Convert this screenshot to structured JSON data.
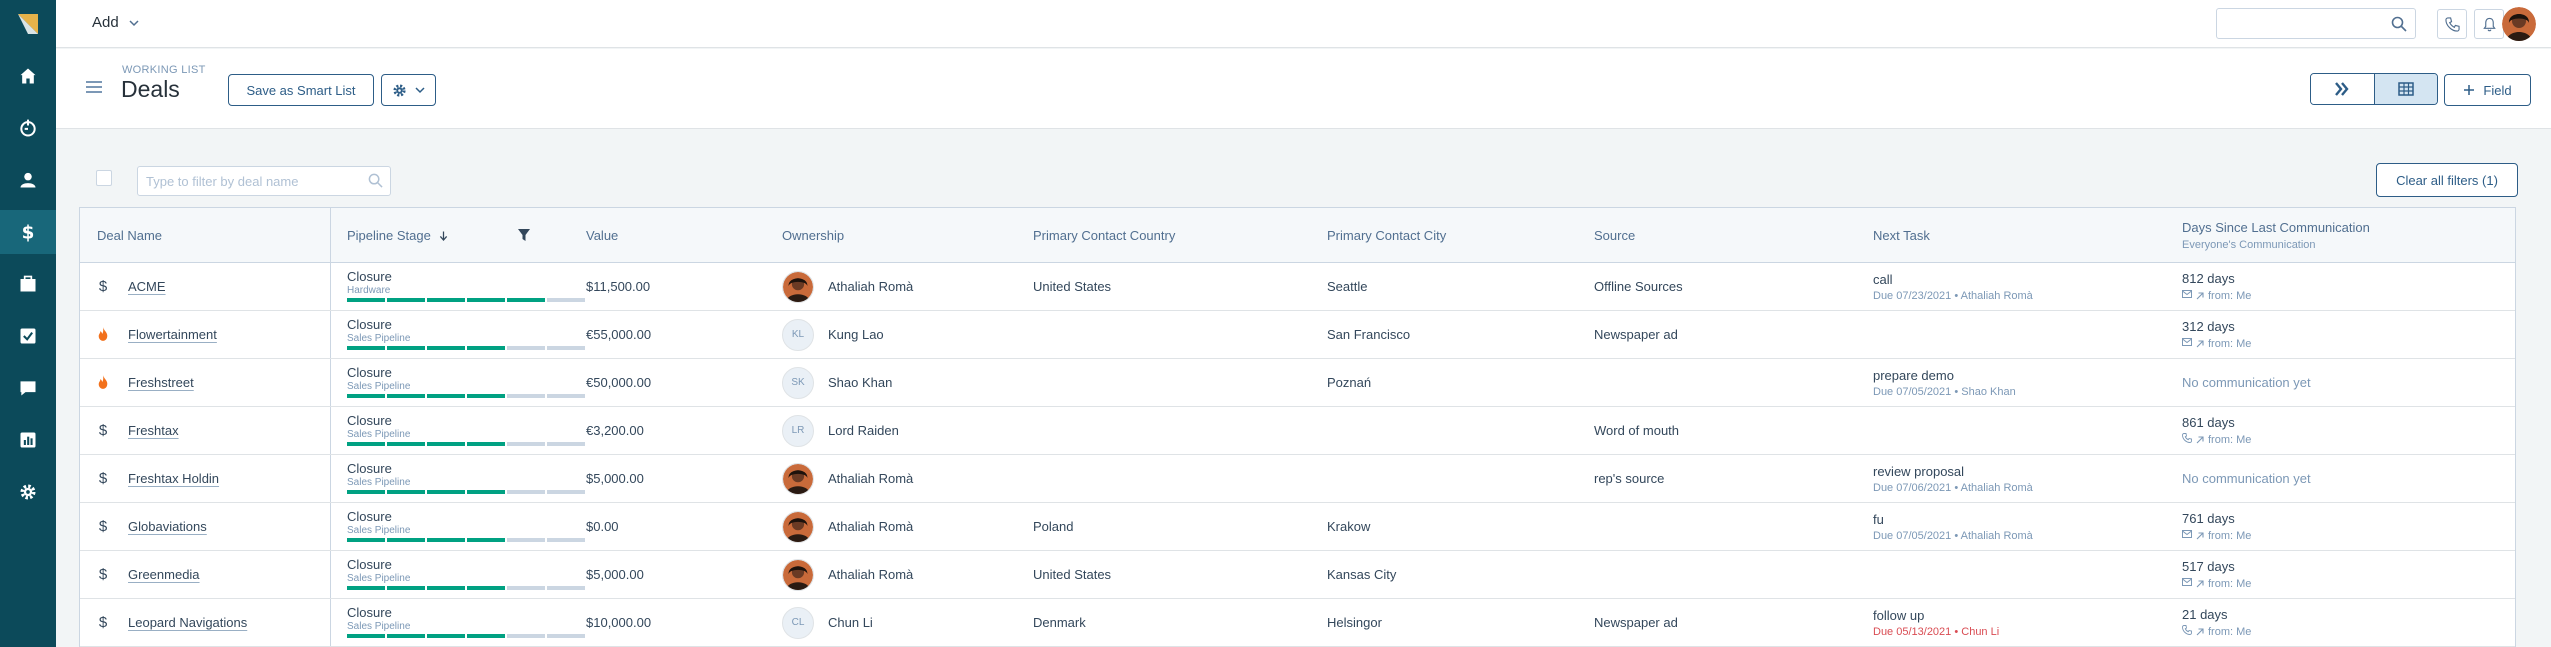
{
  "topbar": {
    "add_label": "Add",
    "search_placeholder": ""
  },
  "header": {
    "eyebrow": "WORKING LIST",
    "title": "Deals",
    "save_smart_list": "Save as Smart List",
    "field_button": "Field"
  },
  "filters": {
    "deal_name_placeholder": "Type to filter by deal name",
    "clear_all": "Clear all filters (1)"
  },
  "columns": {
    "deal_name": "Deal Name",
    "pipeline_stage": "Pipeline Stage",
    "value": "Value",
    "ownership": "Ownership",
    "country": "Primary Contact Country",
    "city": "Primary Contact City",
    "source": "Source",
    "next_task": "Next Task",
    "days_since": "Days Since Last Communication",
    "days_since_sub": "Everyone's Communication"
  },
  "rows": [
    {
      "icon": "dollar-icon",
      "name": "ACME",
      "stage": "Closure",
      "pipeline": "Hardware",
      "progress_steps": 5,
      "value": "$11,500.00",
      "owner": "Athaliah Romà",
      "owner_initials": "",
      "owner_photo": true,
      "country": "United States",
      "city": "Seattle",
      "source": "Offline Sources",
      "task": "call",
      "task_due": "Due 07/23/2021 • Athaliah Romà",
      "task_overdue": false,
      "days": "812 days",
      "comm_via": "mail-icon",
      "comm_from": "from: Me"
    },
    {
      "icon": "flame-icon",
      "name": "Flowertainment",
      "stage": "Closure",
      "pipeline": "Sales Pipeline",
      "progress_steps": 4,
      "value": "€55,000.00",
      "owner": "Kung Lao",
      "owner_initials": "KL",
      "owner_photo": false,
      "country": "",
      "city": "San Francisco",
      "source": "Newspaper ad",
      "task": "",
      "task_due": "",
      "task_overdue": false,
      "days": "312 days",
      "comm_via": "mail-icon",
      "comm_from": "from: Me"
    },
    {
      "icon": "flame-icon",
      "name": "Freshstreet",
      "stage": "Closure",
      "pipeline": "Sales Pipeline",
      "progress_steps": 4,
      "value": "€50,000.00",
      "owner": "Shao Khan",
      "owner_initials": "SK",
      "owner_photo": false,
      "country": "",
      "city": "Poznań",
      "source": "",
      "task": "prepare demo",
      "task_due": "Due 07/05/2021 • Shao Khan",
      "task_overdue": false,
      "days": "No communication yet",
      "comm_via": "",
      "comm_from": ""
    },
    {
      "icon": "dollar-icon",
      "name": "Freshtax",
      "stage": "Closure",
      "pipeline": "Sales Pipeline",
      "progress_steps": 4,
      "value": "€3,200.00",
      "owner": "Lord Raiden",
      "owner_initials": "LR",
      "owner_photo": false,
      "country": "",
      "city": "",
      "source": "Word of mouth",
      "task": "",
      "task_due": "",
      "task_overdue": false,
      "days": "861 days",
      "comm_via": "phone-icon",
      "comm_from": "from: Me"
    },
    {
      "icon": "dollar-icon",
      "name": "Freshtax Holdin",
      "stage": "Closure",
      "pipeline": "Sales Pipeline",
      "progress_steps": 4,
      "value": "$5,000.00",
      "owner": "Athaliah Romà",
      "owner_initials": "",
      "owner_photo": true,
      "country": "",
      "city": "",
      "source": "rep's source",
      "task": "review proposal",
      "task_due": "Due 07/06/2021 • Athaliah Romà",
      "task_overdue": false,
      "days": "No communication yet",
      "comm_via": "",
      "comm_from": ""
    },
    {
      "icon": "dollar-icon",
      "name": "Globaviations",
      "stage": "Closure",
      "pipeline": "Sales Pipeline",
      "progress_steps": 4,
      "value": "$0.00",
      "owner": "Athaliah Romà",
      "owner_initials": "",
      "owner_photo": true,
      "country": "Poland",
      "city": "Krakow",
      "source": "",
      "task": "fu",
      "task_due": "Due 07/05/2021 • Athaliah Romà",
      "task_overdue": false,
      "days": "761 days",
      "comm_via": "mail-icon",
      "comm_from": "from: Me"
    },
    {
      "icon": "dollar-icon",
      "name": "Greenmedia",
      "stage": "Closure",
      "pipeline": "Sales Pipeline",
      "progress_steps": 4,
      "value": "$5,000.00",
      "owner": "Athaliah Romà",
      "owner_initials": "",
      "owner_photo": true,
      "country": "United States",
      "city": "Kansas City",
      "source": "",
      "task": "",
      "task_due": "",
      "task_overdue": false,
      "days": "517 days",
      "comm_via": "mail-icon",
      "comm_from": "from: Me"
    },
    {
      "icon": "dollar-icon",
      "name": "Leopard Navigations",
      "stage": "Closure",
      "pipeline": "Sales Pipeline",
      "progress_steps": 4,
      "value": "$10,000.00",
      "owner": "Chun Li",
      "owner_initials": "CL",
      "owner_photo": false,
      "country": "Denmark",
      "city": "Helsingor",
      "source": "Newspaper ad",
      "task": "follow up",
      "task_due": "Due 05/13/2021 • Chun Li",
      "task_overdue": true,
      "days": "21 days",
      "comm_via": "phone-icon",
      "comm_from": "from: Me"
    }
  ],
  "colors": {
    "nav_bg": "#0c4a5a",
    "nav_active": "#18677a",
    "accent": "#2d5d87",
    "progress_on": "#00a182",
    "progress_off": "#cbd6e2",
    "flame": "#f2711c",
    "overdue": "#d94c53"
  }
}
